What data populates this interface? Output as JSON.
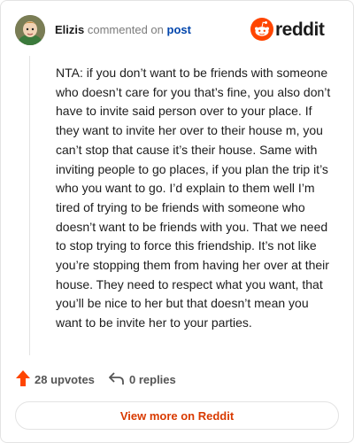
{
  "comment": {
    "username": "Elizis",
    "verb": "commented on",
    "target": "post",
    "body": "NTA: if you don’t want to be friends with someone who doesn’t care for you that’s fine, you also don’t have to invite said person over to your place. If they want to invite her over to their house m, you can’t stop that cause it’s their house. Same with inviting people to go places, if you plan the trip it’s who you want to go. I’d explain to them well I’m tired of trying to be friends with someone who doesn’t want to be friends with you. That we need to stop trying to force this friendship. It’s not like you’re stopping them from having her over at their house. They need to respect what you want, that you’ll be nice to her but that doesn’t mean you want to be invite her to your parties."
  },
  "brand": {
    "name": "reddit",
    "color": "#ff4500"
  },
  "actions": {
    "upvotes_label": "28 upvotes",
    "replies_label": "0 replies"
  },
  "cta": {
    "label": "View more on Reddit"
  },
  "colors": {
    "accent": "#ff4500",
    "link": "#0045ac",
    "cta_text": "#d93a00"
  },
  "icons": [
    "avatar",
    "reddit-logo-icon",
    "upvote-arrow-icon",
    "reply-arrow-icon"
  ]
}
